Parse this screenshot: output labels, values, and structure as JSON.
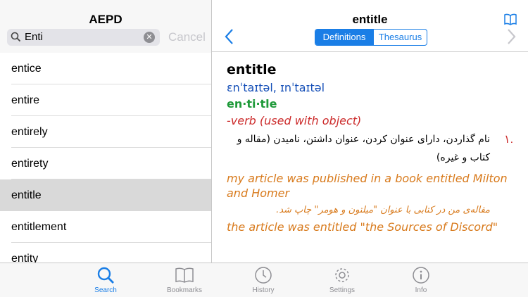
{
  "left": {
    "title": "AEPD",
    "search_value": "Enti",
    "cancel_label": "Cancel",
    "items": [
      "entice",
      "entire",
      "entirely",
      "entirety",
      "entitle",
      "entitlement",
      "entity"
    ],
    "selected": "entitle"
  },
  "right": {
    "title": "entitle",
    "segments": [
      "Definitions",
      "Thesaurus"
    ],
    "active_segment": "Definitions",
    "headword": "entitle",
    "pronunciation": "ɛnˈtaɪtəl, ɪnˈtaɪtəl",
    "syllables": "en·ti·tle",
    "part_of_speech": "-verb (used with object)",
    "sense_number": "۱.",
    "sense_text": "نام گذاردن، دارای عنوان کردن، عنوان داشتن، نامیدن (مقاله و کتاب و غیره)",
    "examples": [
      {
        "en": "my article was published in a book entitled Milton and Homer",
        "fa": "مقاله‌ی من در کتابی با عنوان \"میلتون و هومر\" چاپ شد."
      },
      {
        "en": "the article was entitled \"the Sources of Discord\"",
        "fa": ""
      }
    ]
  },
  "tabbar": {
    "tabs": [
      {
        "label": "Search",
        "icon": "search-icon"
      },
      {
        "label": "Bookmarks",
        "icon": "book-icon"
      },
      {
        "label": "History",
        "icon": "clock-icon"
      },
      {
        "label": "Settings",
        "icon": "gear-icon"
      },
      {
        "label": "Info",
        "icon": "info-icon"
      }
    ],
    "active": "Search"
  },
  "colors": {
    "accent": "#1a7ee6",
    "pronunciation": "#1650b8",
    "syllables": "#1f9a3a",
    "part_of_speech": "#cc2b2b",
    "example": "#d87a1c"
  }
}
